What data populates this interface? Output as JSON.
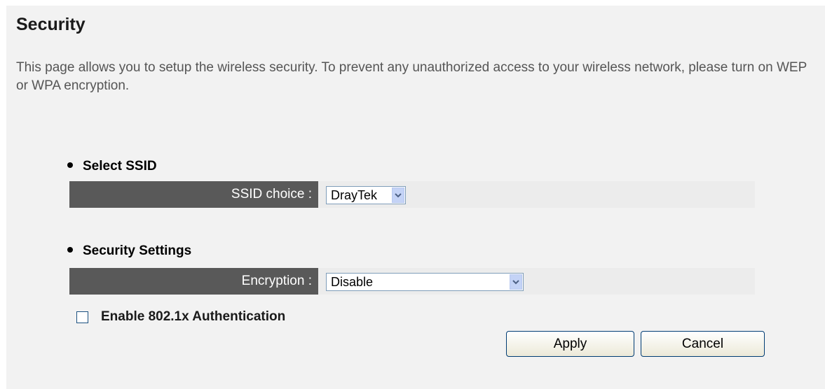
{
  "page": {
    "title": "Security",
    "description": "This page allows you to setup the wireless security. To prevent any unauthorized access to your wireless network, please turn on WEP or WPA encryption."
  },
  "ssid_section": {
    "heading": "Select SSID",
    "label": "SSID choice :",
    "selected": "DrayTek"
  },
  "security_section": {
    "heading": "Security Settings",
    "label": "Encryption :",
    "selected": "Disable"
  },
  "auth": {
    "label": "Enable 802.1x Authentication",
    "checked": false
  },
  "buttons": {
    "apply": "Apply",
    "cancel": "Cancel"
  },
  "icons": {
    "dropdown": "chevron-down-icon",
    "checkbox": "checkbox-icon"
  },
  "colors": {
    "panel_bg": "#f2f2f2",
    "label_bg": "#595959",
    "arrow_bg": "#c4d3f6"
  }
}
